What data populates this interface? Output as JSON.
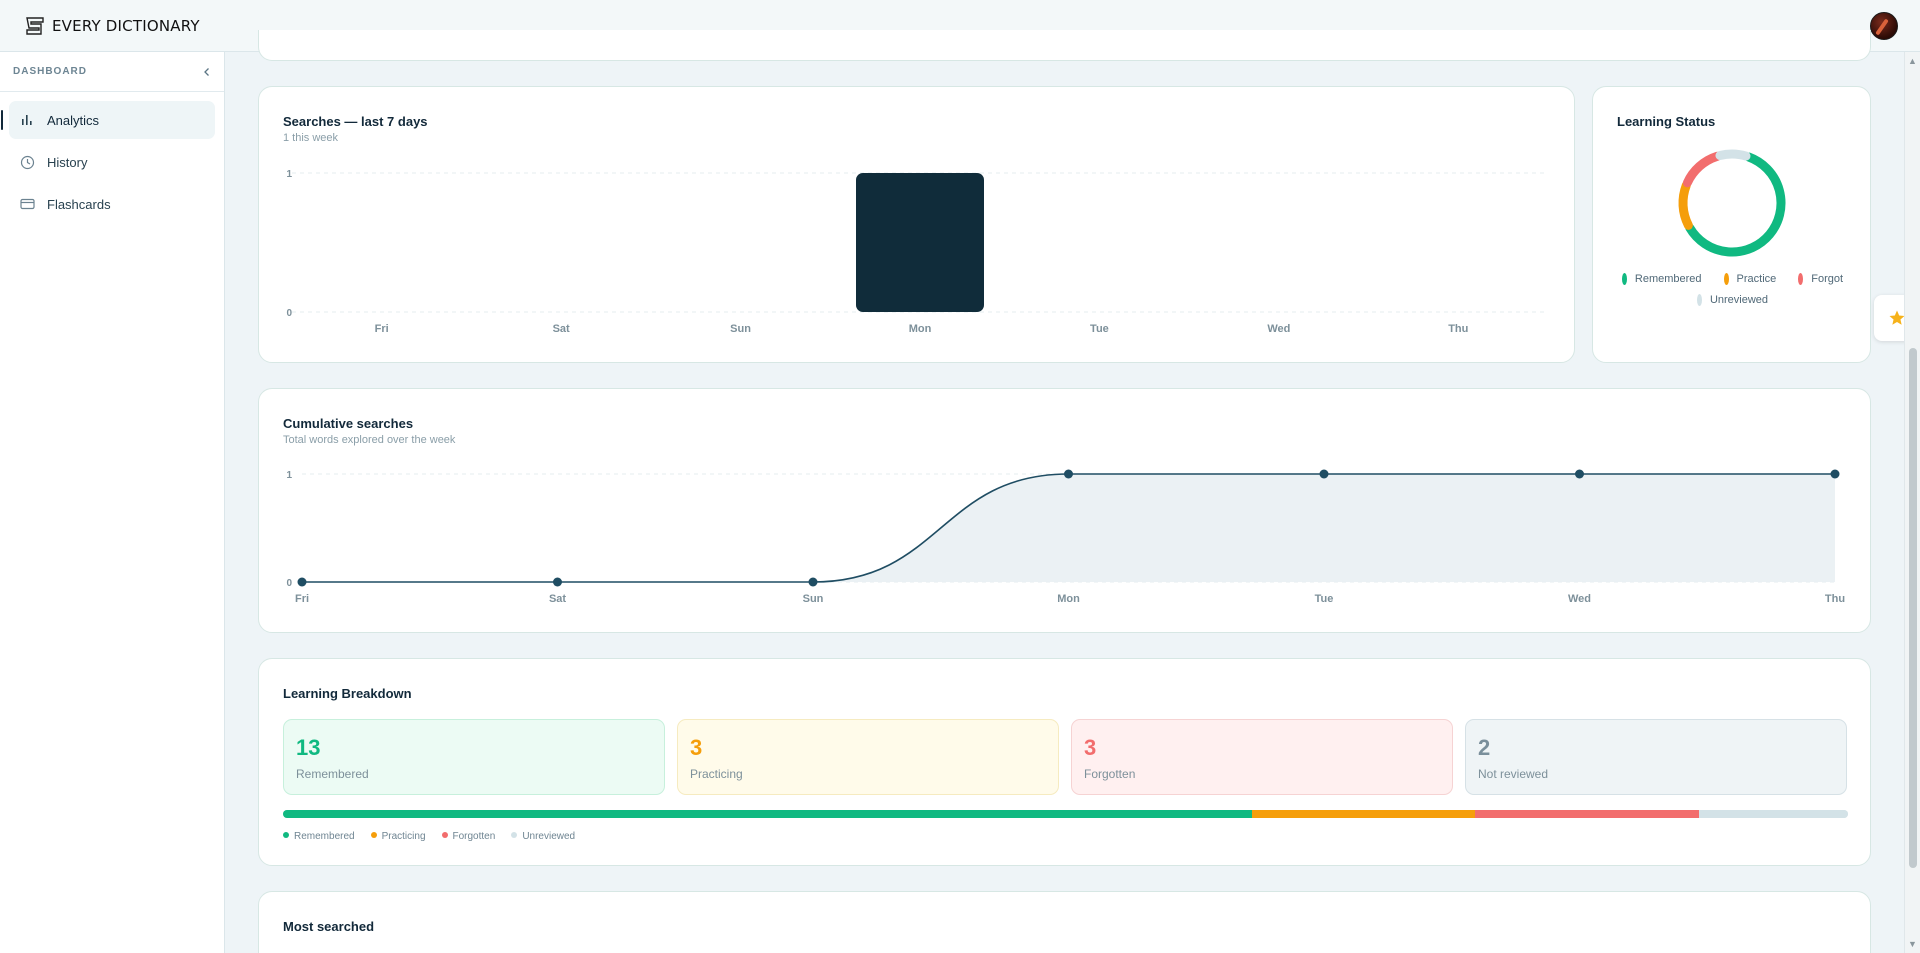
{
  "header": {
    "brand": "EVERY DICTIONARY"
  },
  "sidebar": {
    "title": "DASHBOARD",
    "items": [
      {
        "label": "Analytics",
        "icon": "bar-chart-icon",
        "active": true
      },
      {
        "label": "History",
        "icon": "clock-icon",
        "active": false
      },
      {
        "label": "Flashcards",
        "icon": "card-icon",
        "active": false
      }
    ]
  },
  "searches_card": {
    "title": "Searches — last 7 days",
    "subtitle": "1 this week"
  },
  "status_card": {
    "title": "Learning Status",
    "legend": [
      {
        "label": "Remembered",
        "color": "#10b981"
      },
      {
        "label": "Practice",
        "color": "#f59e0b"
      },
      {
        "label": "Forgot",
        "color": "#f26d6d"
      },
      {
        "label": "Unreviewed",
        "color": "#d3e2e7"
      }
    ]
  },
  "cumulative_card": {
    "title": "Cumulative searches",
    "subtitle": "Total words explored over the week"
  },
  "breakdown": {
    "title": "Learning Breakdown",
    "stats": [
      {
        "value": "13",
        "label": "Remembered",
        "color": "#10b981",
        "bg": "#ecfbf4",
        "border": "#c7f0dc"
      },
      {
        "value": "3",
        "label": "Practicing",
        "color": "#f59e0b",
        "bg": "#fffbea",
        "border": "#f6ebc0"
      },
      {
        "value": "3",
        "label": "Forgotten",
        "color": "#f26d6d",
        "bg": "#fff0f0",
        "border": "#f6d3d3"
      },
      {
        "value": "2",
        "label": "Not reviewed",
        "color": "#7a8f9b",
        "bg": "#eff4f6",
        "border": "#d6e1e6"
      }
    ],
    "legend": [
      "Remembered",
      "Practicing",
      "Forgotten",
      "Unreviewed"
    ]
  },
  "most_searched": {
    "title": "Most searched"
  },
  "chart_data": [
    {
      "type": "bar",
      "title": "Searches — last 7 days",
      "categories": [
        "Fri",
        "Sat",
        "Sun",
        "Mon",
        "Tue",
        "Wed",
        "Thu"
      ],
      "values": [
        0,
        0,
        0,
        1,
        0,
        0,
        0
      ],
      "ylim": [
        0,
        1
      ],
      "yticks": [
        0,
        1
      ],
      "grid": true,
      "color": "#102c3a"
    },
    {
      "type": "pie",
      "title": "Learning Status",
      "labels": [
        "Remembered",
        "Practice",
        "Forgot",
        "Unreviewed"
      ],
      "values": [
        13,
        3,
        3,
        2
      ],
      "colors": [
        "#10b981",
        "#f59e0b",
        "#f26d6d",
        "#d3e2e7"
      ],
      "donut": true,
      "legend": "bottom"
    },
    {
      "type": "area",
      "title": "Cumulative searches",
      "categories": [
        "Fri",
        "Sat",
        "Sun",
        "Mon",
        "Tue",
        "Wed",
        "Thu"
      ],
      "values": [
        0,
        0,
        0,
        1,
        1,
        1,
        1
      ],
      "ylim": [
        0,
        1
      ],
      "yticks": [
        0,
        1
      ],
      "grid": true,
      "color": "#1f4d63"
    }
  ]
}
